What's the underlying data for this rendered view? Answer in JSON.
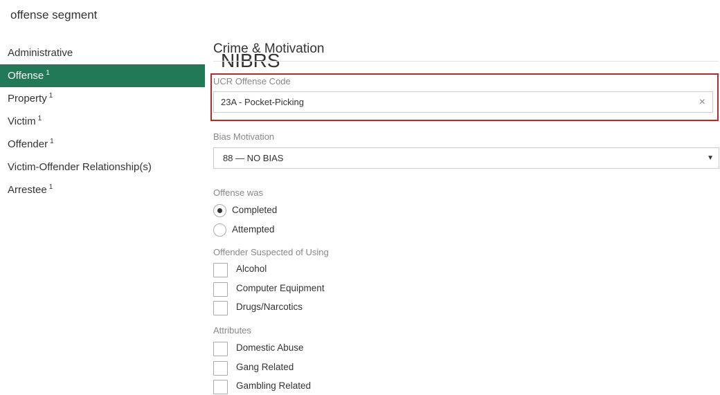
{
  "header": {
    "title": "NIBRS",
    "subtitle": "offense segment"
  },
  "sidebar": {
    "items": [
      {
        "label": "Administrative",
        "badge": ""
      },
      {
        "label": "Offense",
        "badge": "1",
        "active": true
      },
      {
        "label": "Property",
        "badge": "1"
      },
      {
        "label": "Victim",
        "badge": "1"
      },
      {
        "label": "Offender",
        "badge": "1"
      },
      {
        "label": "Victim-Offender Relationship(s)",
        "badge": ""
      },
      {
        "label": "Arrestee",
        "badge": "1"
      }
    ]
  },
  "main": {
    "section_title": "Crime & Motivation",
    "ucr": {
      "label": "UCR Offense Code",
      "value": "23A - Pocket-Picking",
      "clear_icon": "×"
    },
    "bias": {
      "label": "Bias Motivation",
      "value": "88 — NO BIAS",
      "caret_icon": "▼"
    },
    "offense_was": {
      "label": "Offense was",
      "options": [
        {
          "label": "Completed",
          "checked": true
        },
        {
          "label": "Attempted",
          "checked": false
        }
      ]
    },
    "suspected": {
      "label": "Offender Suspected of Using",
      "options": [
        {
          "label": "Alcohol",
          "checked": false
        },
        {
          "label": "Computer Equipment",
          "checked": false
        },
        {
          "label": "Drugs/Narcotics",
          "checked": false
        }
      ]
    },
    "attributes": {
      "label": "Attributes",
      "options": [
        {
          "label": "Domestic Abuse",
          "checked": false
        },
        {
          "label": "Gang Related",
          "checked": false
        },
        {
          "label": "Gambling Related",
          "checked": false
        }
      ]
    }
  },
  "colors": {
    "active_bg": "#217a55",
    "highlight_border": "#b22a2a"
  }
}
